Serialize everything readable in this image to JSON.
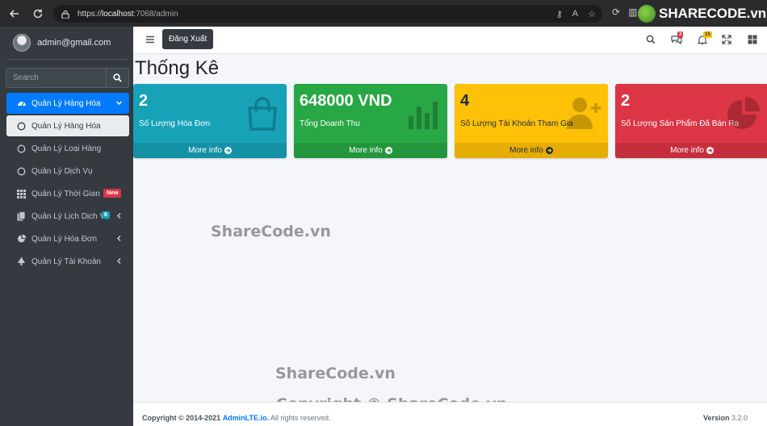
{
  "browser": {
    "url_scheme": "https://",
    "url_host": "localhost",
    "url_path": ":7068/admin",
    "brand_text": "SHARECODE.vn"
  },
  "sidebar": {
    "user_email": "admin@gmail.com",
    "search_placeholder": "Search",
    "items": [
      {
        "label": "Quản Lý Hàng Hóa",
        "icon": "dashboard-icon",
        "active": true
      },
      {
        "label": "Quản Lý Hàng Hóa",
        "icon": "circle-icon",
        "sub_active": true
      },
      {
        "label": "Quản Lý Loại Hàng",
        "icon": "circle-icon"
      },
      {
        "label": "Quản Lý Dịch Vụ",
        "icon": "circle-icon"
      },
      {
        "label": "Quản Lý Thời Gian",
        "icon": "grid-icon",
        "badge": "New"
      },
      {
        "label": "Quản Lý Lịch Dịch Vụ",
        "icon": "copy-icon",
        "badge": "6"
      },
      {
        "label": "Quản Lý Hóa Đơn",
        "icon": "pie-chart-icon"
      },
      {
        "label": "Quản Lý Tài Khoản",
        "icon": "tree-icon"
      }
    ]
  },
  "navbar": {
    "logout_label": "Đăng Xuất",
    "messages_badge": "3",
    "notifications_badge": "15"
  },
  "main": {
    "title": "Thống Kê",
    "boxes": [
      {
        "value": "2",
        "label": "Số Lượng Hóa Đơn",
        "more": "More info",
        "color": "#17a2b8",
        "icon": "shopping-bag-icon"
      },
      {
        "value": "648000 VND",
        "label": "Tổng Doanh Thu",
        "more": "More info",
        "color": "#28a745",
        "icon": "bar-chart-icon"
      },
      {
        "value": "4",
        "label": "Số Lượng Tài Khoản Tham Gia",
        "more": "More info",
        "color": "#ffc107",
        "icon": "user-plus-icon"
      },
      {
        "value": "2",
        "label": "Số Lượng Sản Phẩm Đã Bán Ra",
        "more": "More info",
        "color": "#dc3545",
        "icon": "pie-chart-icon"
      }
    ]
  },
  "watermarks": {
    "top": "ShareCode.vn",
    "middle": "ShareCode.vn",
    "bottom": "Copyright © ShareCode.vn"
  },
  "footer": {
    "copyright": "Copyright © 2014-2021",
    "brand": "AdminLTE.io.",
    "rights": "All rights reserved.",
    "version_label": "Version",
    "version": "3.2.0"
  }
}
